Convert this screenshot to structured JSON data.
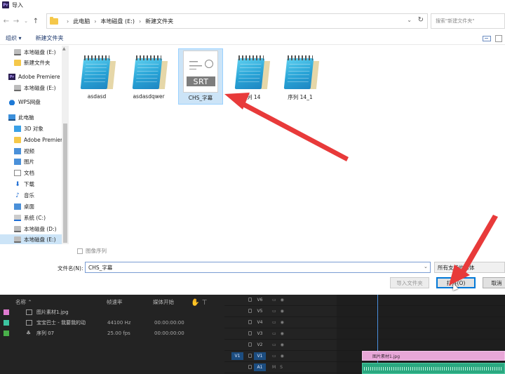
{
  "window": {
    "title": "导入",
    "logo_text": "Pr"
  },
  "nav": {
    "breadcrumb": [
      "此电脑",
      "本地磁盘 (E:)",
      "新建文件夹"
    ],
    "search_placeholder": "搜索\"新建文件夹\""
  },
  "toolbar": {
    "organize": "组织 ▾",
    "new_folder": "新建文件夹"
  },
  "sidebar": {
    "items": [
      {
        "label": "本地磁盘 (E:)",
        "icon": "drive-icon"
      },
      {
        "label": "新建文件夹",
        "icon": "folder-icon"
      },
      {
        "label": "Adobe Premiere",
        "icon": "premiere-icon"
      },
      {
        "label": "本地磁盘 (E:)",
        "icon": "drive-icon"
      },
      {
        "label": "WPS网盘",
        "icon": "cloud-icon"
      },
      {
        "label": "此电脑",
        "icon": "computer-icon"
      },
      {
        "label": "3D 对象",
        "icon": "cube-icon"
      },
      {
        "label": "Adobe Premiere",
        "icon": "folder-icon"
      },
      {
        "label": "视频",
        "icon": "video-icon"
      },
      {
        "label": "图片",
        "icon": "picture-icon"
      },
      {
        "label": "文档",
        "icon": "document-icon"
      },
      {
        "label": "下载",
        "icon": "download-icon"
      },
      {
        "label": "音乐",
        "icon": "music-icon"
      },
      {
        "label": "桌面",
        "icon": "desktop-icon"
      },
      {
        "label": "系统 (C:)",
        "icon": "windows-drive-icon"
      },
      {
        "label": "本地磁盘 (D:)",
        "icon": "drive-icon"
      },
      {
        "label": "本地磁盘 (E:)",
        "icon": "drive-icon"
      }
    ]
  },
  "files": [
    {
      "name": "asdasd",
      "type": "notepad"
    },
    {
      "name": "asdasdqwer",
      "type": "notepad"
    },
    {
      "name": "CHS_字幕",
      "type": "srt",
      "badge": "SRT",
      "selected": true
    },
    {
      "name": "序列 14",
      "type": "notepad"
    },
    {
      "name": "序列 14_1",
      "type": "notepad"
    }
  ],
  "bottom": {
    "image_sequence": "图像序列",
    "filename_label": "文件名(N):",
    "filename_value": "CHS_字幕",
    "filetype_value": "所有支持的媒体",
    "import_folder": "导入文件夹",
    "open": "打开(O)",
    "cancel": "取消"
  },
  "project": {
    "headers": {
      "name": "名称",
      "framerate": "帧速率",
      "media_start": "媒体开始"
    },
    "rows": [
      {
        "color": "#e07ad0",
        "name": "图片素材1.jpg",
        "rate": "",
        "start": ""
      },
      {
        "color": "#3cc4a0",
        "name": "宝宝巴士 - 我要我的动",
        "rate": "44100 Hz",
        "start": "00:00:00:00"
      },
      {
        "color": "#49b04a",
        "name": "序列 07",
        "rate": "25.00 fps",
        "start": "00:00:00:00"
      }
    ]
  },
  "timeline": {
    "tracks": [
      "V6",
      "V5",
      "V4",
      "V3",
      "V2",
      "V1",
      "A1"
    ],
    "source_v": "V1",
    "clip_name": "图片素材1.jpg"
  },
  "colors": {
    "accent": "#0078d7",
    "selection": "#cce4f7",
    "arrow": "#e83a3a"
  }
}
